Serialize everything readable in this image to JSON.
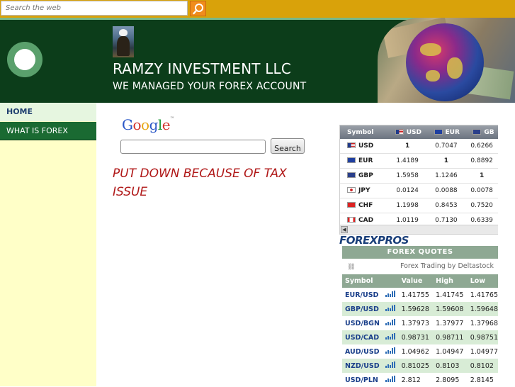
{
  "topbar": {
    "search_placeholder": "Search the web"
  },
  "header": {
    "company": "RAMZY INVESTMENT LLC",
    "tagline": "WE MANAGED YOUR FOREX ACCOUNT"
  },
  "nav": {
    "items": [
      {
        "label": "HOME"
      },
      {
        "label": "WHAT IS FOREX"
      }
    ]
  },
  "google_search": {
    "logo": {
      "letters": [
        "G",
        "o",
        "o",
        "g",
        "l",
        "e"
      ],
      "tm": "™"
    },
    "button": "Search"
  },
  "notice": "PUT DOWN BECAUSE OF TAX ISSUE",
  "cross_rates": {
    "header": [
      "Symbol",
      "USD",
      "EUR",
      "GB"
    ],
    "rows": [
      [
        "USD",
        "1",
        "0.7047",
        "0.6266"
      ],
      [
        "EUR",
        "1.4189",
        "1",
        "0.8892"
      ],
      [
        "GBP",
        "1.5958",
        "1.1246",
        "1"
      ],
      [
        "JPY",
        "0.0124",
        "0.0088",
        "0.0078"
      ],
      [
        "CHF",
        "1.1998",
        "0.8453",
        "0.7520"
      ],
      [
        "CAD",
        "1.0119",
        "0.7130",
        "0.6339"
      ]
    ],
    "scroll_arrow": "◀",
    "brand": "FOREXPROS"
  },
  "forex_quotes": {
    "title": "FOREX QUOTES",
    "sponsor": "Forex Trading by Deltastock",
    "columns": [
      "Symbol",
      "",
      "Value",
      "High",
      "Low"
    ],
    "rows": [
      [
        "EUR/USD",
        "1.41755",
        "1.41745",
        "1.41765"
      ],
      [
        "GBP/USD",
        "1.59628",
        "1.59608",
        "1.59648"
      ],
      [
        "USD/BGN",
        "1.37973",
        "1.37977",
        "1.37968"
      ],
      [
        "USD/CAD",
        "0.98731",
        "0.98711",
        "0.98751"
      ],
      [
        "AUD/USD",
        "1.04962",
        "1.04947",
        "1.04977"
      ],
      [
        "NZD/USD",
        "0.81025",
        "0.8103",
        "0.8102"
      ],
      [
        "USD/PLN",
        "2.812",
        "2.8095",
        "2.8145"
      ]
    ]
  },
  "colors": {
    "top_bar": "#d9a20a",
    "header_bg": "#0c3d1a",
    "sidebar_bg": "#ffffc8",
    "notice_text": "#b01818",
    "quote_header": "#8ea893",
    "quote_row_alt": "#d8ecd6"
  }
}
